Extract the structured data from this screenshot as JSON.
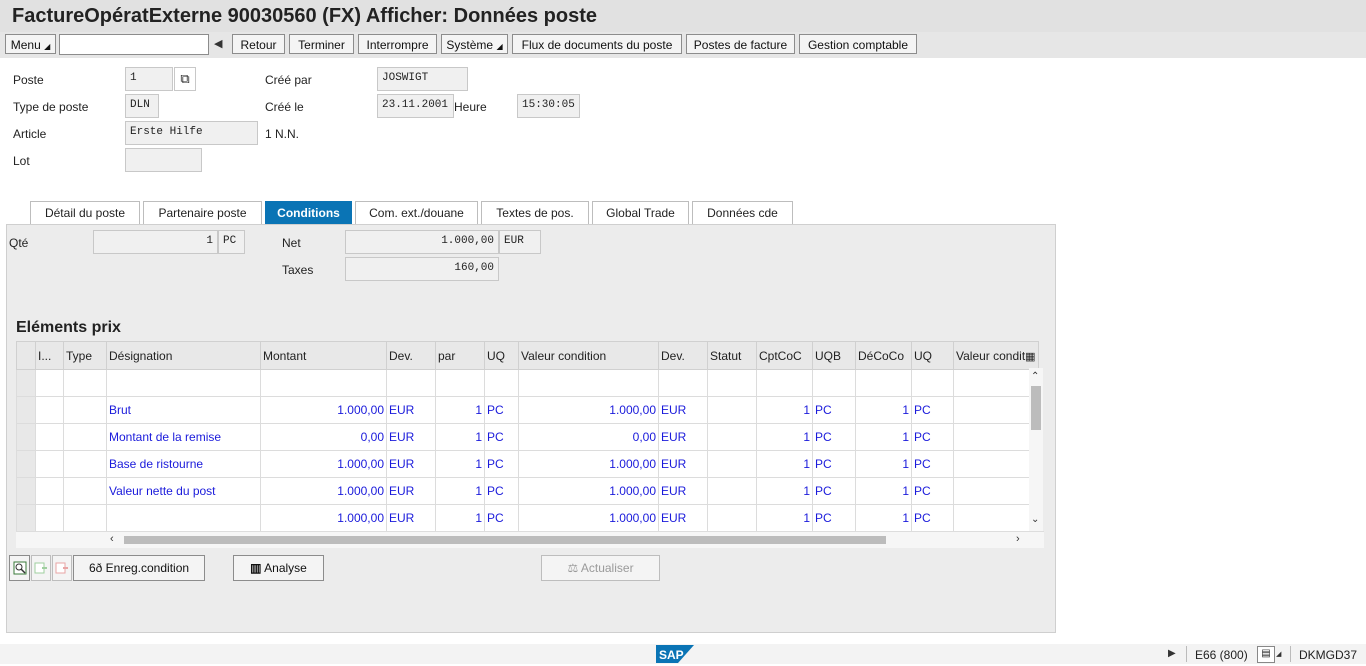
{
  "title": "FactureOpératExterne 90030560   (FX) Afficher: Données poste",
  "toolbar": {
    "menu": "Menu",
    "back": "Retour",
    "finish": "Terminer",
    "interrupt": "Interrompre",
    "system": "Système",
    "doc_flow": "Flux de documents du poste",
    "invoice_items": "Postes de facture",
    "accounting": "Gestion comptable"
  },
  "header": {
    "poste_label": "Poste",
    "poste_value": "1",
    "type_label": "Type de poste",
    "type_value": "DLN",
    "article_label": "Article",
    "article_value": "Erste Hilfe",
    "article_desc": "1 N.N.",
    "lot_label": "Lot",
    "lot_value": "",
    "created_by_label": "Créé par",
    "created_by_value": "JOSWIGT",
    "created_on_label": "Créé le",
    "created_on_value": "23.11.2001",
    "time_label": "Heure",
    "time_value": "15:30:05"
  },
  "tabs": [
    "Détail du poste",
    "Partenaire poste",
    "Conditions",
    "Com. ext./douane",
    "Textes de pos.",
    "Global Trade",
    "Données cde"
  ],
  "active_tab": "Conditions",
  "conditions": {
    "qty_label": "Qté",
    "qty_value": "1",
    "qty_unit": "PC",
    "net_label": "Net",
    "net_value": "1.000,00",
    "net_currency": "EUR",
    "tax_label": "Taxes",
    "tax_value": "160,00"
  },
  "pricing": {
    "title": "Eléments prix",
    "columns": [
      "I...",
      "Type",
      "Désignation",
      "Montant",
      "Dev.",
      "par",
      "UQ",
      "Valeur condition",
      "Dev.",
      "Statut",
      "CptCoC",
      "UQB",
      "DéCoCo",
      "UQ",
      "Valeur condit"
    ],
    "rows": [
      {
        "designation": "",
        "amount": "",
        "currency": "",
        "per": "",
        "uq": "",
        "cond_value": "",
        "cond_currency": "",
        "cptcoc": "",
        "uqb": "",
        "decoco": "",
        "uq2": ""
      },
      {
        "designation": "Brut",
        "amount": "1.000,00",
        "currency": "EUR",
        "per": "1",
        "uq": "PC",
        "cond_value": "1.000,00",
        "cond_currency": "EUR",
        "cptcoc": "1",
        "uqb": "PC",
        "decoco": "1",
        "uq2": "PC"
      },
      {
        "designation": "Montant de la remise",
        "amount": "0,00",
        "currency": "EUR",
        "per": "1",
        "uq": "PC",
        "cond_value": "0,00",
        "cond_currency": "EUR",
        "cptcoc": "1",
        "uqb": "PC",
        "decoco": "1",
        "uq2": "PC"
      },
      {
        "designation": "Base de ristourne",
        "amount": "1.000,00",
        "currency": "EUR",
        "per": "1",
        "uq": "PC",
        "cond_value": "1.000,00",
        "cond_currency": "EUR",
        "cptcoc": "1",
        "uqb": "PC",
        "decoco": "1",
        "uq2": "PC"
      },
      {
        "designation": "Valeur nette du post",
        "amount": "1.000,00",
        "currency": "EUR",
        "per": "1",
        "uq": "PC",
        "cond_value": "1.000,00",
        "cond_currency": "EUR",
        "cptcoc": "1",
        "uqb": "PC",
        "decoco": "1",
        "uq2": "PC"
      },
      {
        "designation": "",
        "amount": "1.000,00",
        "currency": "EUR",
        "per": "1",
        "uq": "PC",
        "cond_value": "1.000,00",
        "cond_currency": "EUR",
        "cptcoc": "1",
        "uqb": "PC",
        "decoco": "1",
        "uq2": "PC"
      }
    ]
  },
  "buttons": {
    "record_condition": "Enreg.condition",
    "analysis": "Analyse",
    "update": "Actualiser"
  },
  "statusbar": {
    "sap_logo": "SAP",
    "system": "E66 (800)",
    "server": "DKMGD37"
  },
  "colors": {
    "active_tab": "#0a74b5",
    "link_text": "#1a1adb",
    "logo": "#0a74b5"
  }
}
